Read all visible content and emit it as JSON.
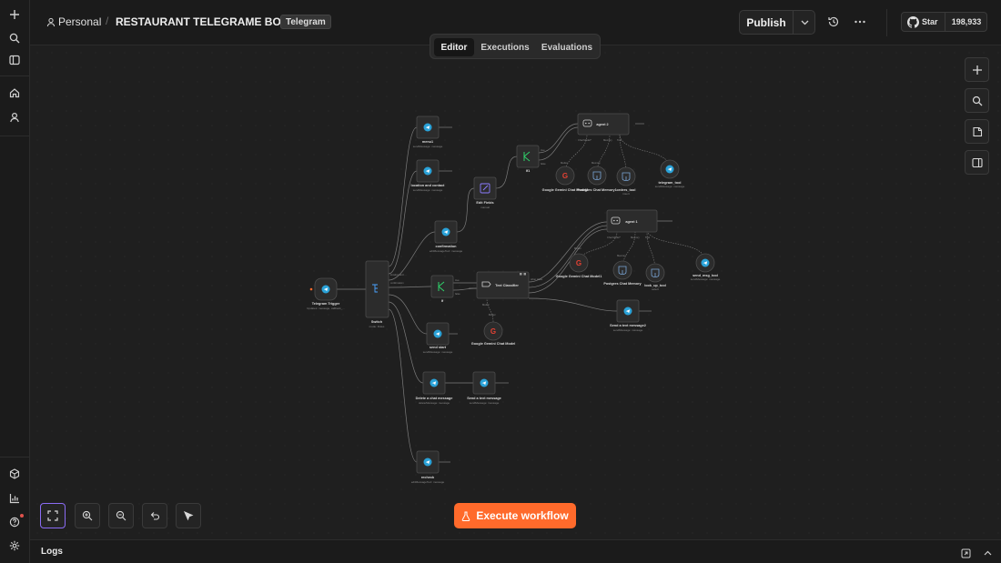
{
  "header": {
    "project": "Personal",
    "separator": "/",
    "workflow_name": "RESTAURANT TELEGRAME BOT",
    "tag": "Telegram",
    "publish_label": "Publish",
    "github_star_label": "Star",
    "github_star_count": "198,933"
  },
  "tabs": [
    {
      "label": "Editor",
      "active": true
    },
    {
      "label": "Executions",
      "active": false
    },
    {
      "label": "Evaluations",
      "active": false
    }
  ],
  "execute_label": "Execute workflow",
  "logs_label": "Logs",
  "colors": {
    "accent_orange": "#ff6a2b",
    "telegram_blue": "#2aa2d8",
    "switch_blue": "#4aa3ff",
    "if_green": "#2fd16a",
    "edit_purple": "#8b7bff",
    "canvas_bg": "#1f1f1f"
  },
  "nodes": {
    "telegram_trigger": {
      "label": "Telegram Trigger",
      "sub": "Updates: message, callback_..."
    },
    "switch": {
      "label": "Switch",
      "sub": "mode: Rules"
    },
    "menu1": {
      "label": "menu1",
      "sub": "sendMessage: message"
    },
    "location": {
      "label": "location and contact",
      "sub": "sendMessage: message"
    },
    "confirmation": {
      "label": "confirmation",
      "sub": "editMessageText: message"
    },
    "if_a": {
      "label": "If"
    },
    "send_start": {
      "label": "send start",
      "sub": "sendMessage: message"
    },
    "delete_msg": {
      "label": "Delete a chat message",
      "sub": "deleteMessage: message"
    },
    "send_text": {
      "label": "Send a text message",
      "sub": "sendMessage: message"
    },
    "recheck": {
      "label": "recheck",
      "sub": "editMessageText: message"
    },
    "edit_fields": {
      "label": "Edit Fields",
      "sub": "manual"
    },
    "if1": {
      "label": "If1"
    },
    "agent2": {
      "label": "agent 2"
    },
    "gemini2": {
      "label": "Google Gemini Chat Model2"
    },
    "pg_memory1": {
      "label": "Postgres Chat Memory1"
    },
    "orders_tool": {
      "label": "orders_tool",
      "sub": "insert"
    },
    "telegram_tool": {
      "label": "telegram_tool",
      "sub": "sendMessage: message"
    },
    "agent1": {
      "label": "agent 1"
    },
    "gemini1": {
      "label": "Google Gemini Chat Model1"
    },
    "pg_memory": {
      "label": "Postgres Chat Memory"
    },
    "look_up_tool": {
      "label": "look_up_tool",
      "sub": "select"
    },
    "send_msg_tool": {
      "label": "send_msg_tool",
      "sub": "sendMessage: message"
    },
    "text_classifier": {
      "label": "Text Classifier"
    },
    "gemini": {
      "label": "Google Gemini Chat Model"
    },
    "send_text2": {
      "label": "Send a text message2",
      "sub": "sendMessage: message"
    }
  },
  "ports": {
    "model": "Model",
    "chat_model": "Chat Model*",
    "memory": "Memory",
    "tool": "Tool",
    "true": "true",
    "false": "false",
    "other_class": "other class",
    "location_and": "location and ...",
    "confirmation": "confirmation"
  }
}
